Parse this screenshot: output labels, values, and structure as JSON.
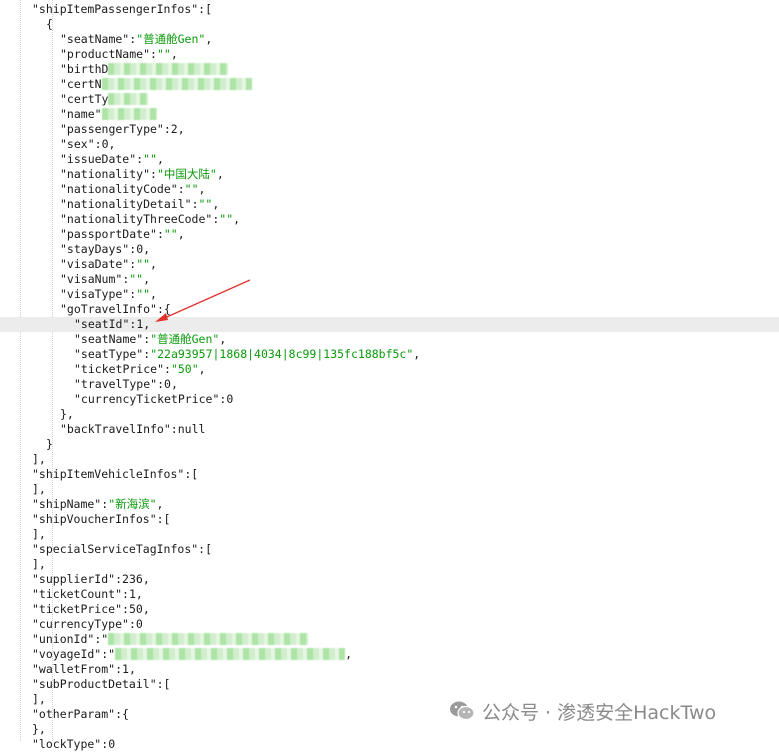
{
  "lines": [
    [
      {
        "t": "k",
        "v": "\"shipItemPassengerInfos\""
      },
      {
        "t": "p",
        "v": ":["
      }
    ],
    [
      {
        "t": "p",
        "v": "{"
      }
    ],
    [
      {
        "t": "k",
        "v": "\"seatName\""
      },
      {
        "t": "p",
        "v": ":"
      },
      {
        "t": "s",
        "v": "\"普通舱Gen\""
      },
      {
        "t": "p",
        "v": ","
      }
    ],
    [
      {
        "t": "k",
        "v": "\"productName\""
      },
      {
        "t": "p",
        "v": ":"
      },
      {
        "t": "s",
        "v": "\"\""
      },
      {
        "t": "p",
        "v": ","
      }
    ],
    [
      {
        "t": "k",
        "v": "\"birthD"
      },
      {
        "t": "m",
        "v": ""
      }
    ],
    [
      {
        "t": "k",
        "v": "\"certN"
      },
      {
        "t": "m",
        "v": ""
      }
    ],
    [
      {
        "t": "k",
        "v": "\"certTy"
      },
      {
        "t": "m",
        "v": ""
      }
    ],
    [
      {
        "t": "k",
        "v": "\"name\""
      },
      {
        "t": "m",
        "v": ""
      }
    ],
    [
      {
        "t": "k",
        "v": "\"passengerType\""
      },
      {
        "t": "p",
        "v": ":"
      },
      {
        "t": "n",
        "v": "2"
      },
      {
        "t": "p",
        "v": ","
      }
    ],
    [
      {
        "t": "k",
        "v": "\"sex\""
      },
      {
        "t": "p",
        "v": ":"
      },
      {
        "t": "n",
        "v": "0"
      },
      {
        "t": "p",
        "v": ","
      }
    ],
    [
      {
        "t": "k",
        "v": "\"issueDate\""
      },
      {
        "t": "p",
        "v": ":"
      },
      {
        "t": "s",
        "v": "\"\""
      },
      {
        "t": "p",
        "v": ","
      }
    ],
    [
      {
        "t": "k",
        "v": "\"nationality\""
      },
      {
        "t": "p",
        "v": ":"
      },
      {
        "t": "s",
        "v": "\"中国大陆\""
      },
      {
        "t": "p",
        "v": ","
      }
    ],
    [
      {
        "t": "k",
        "v": "\"nationalityCode\""
      },
      {
        "t": "p",
        "v": ":"
      },
      {
        "t": "s",
        "v": "\"\""
      },
      {
        "t": "p",
        "v": ","
      }
    ],
    [
      {
        "t": "k",
        "v": "\"nationalityDetail\""
      },
      {
        "t": "p",
        "v": ":"
      },
      {
        "t": "s",
        "v": "\"\""
      },
      {
        "t": "p",
        "v": ","
      }
    ],
    [
      {
        "t": "k",
        "v": "\"nationalityThreeCode\""
      },
      {
        "t": "p",
        "v": ":"
      },
      {
        "t": "s",
        "v": "\"\""
      },
      {
        "t": "p",
        "v": ","
      }
    ],
    [
      {
        "t": "k",
        "v": "\"passportDate\""
      },
      {
        "t": "p",
        "v": ":"
      },
      {
        "t": "s",
        "v": "\"\""
      },
      {
        "t": "p",
        "v": ","
      }
    ],
    [
      {
        "t": "k",
        "v": "\"stayDays\""
      },
      {
        "t": "p",
        "v": ":"
      },
      {
        "t": "n",
        "v": "0"
      },
      {
        "t": "p",
        "v": ","
      }
    ],
    [
      {
        "t": "k",
        "v": "\"visaDate\""
      },
      {
        "t": "p",
        "v": ":"
      },
      {
        "t": "s",
        "v": "\"\""
      },
      {
        "t": "p",
        "v": ","
      }
    ],
    [
      {
        "t": "k",
        "v": "\"visaNum\""
      },
      {
        "t": "p",
        "v": ":"
      },
      {
        "t": "s",
        "v": "\"\""
      },
      {
        "t": "p",
        "v": ","
      }
    ],
    [
      {
        "t": "k",
        "v": "\"visaType\""
      },
      {
        "t": "p",
        "v": ":"
      },
      {
        "t": "s",
        "v": "\"\""
      },
      {
        "t": "p",
        "v": ","
      }
    ],
    [
      {
        "t": "k",
        "v": "\"goTravelInfo\""
      },
      {
        "t": "p",
        "v": ":{"
      }
    ],
    [
      {
        "t": "k",
        "v": "\"seatId\""
      },
      {
        "t": "p",
        "v": ":"
      },
      {
        "t": "n",
        "v": "1"
      },
      {
        "t": "p",
        "v": ","
      }
    ],
    [
      {
        "t": "k",
        "v": "\"seatName\""
      },
      {
        "t": "p",
        "v": ":"
      },
      {
        "t": "s",
        "v": "\"普通舱Gen\""
      },
      {
        "t": "p",
        "v": ","
      }
    ],
    [
      {
        "t": "k",
        "v": "\"seatType\""
      },
      {
        "t": "p",
        "v": ":"
      },
      {
        "t": "s",
        "v": "\"22a93957|1868|4034|8c99|135fc188bf5c\""
      },
      {
        "t": "p",
        "v": ","
      }
    ],
    [
      {
        "t": "k",
        "v": "\"ticketPrice\""
      },
      {
        "t": "p",
        "v": ":"
      },
      {
        "t": "s",
        "v": "\"50\""
      },
      {
        "t": "p",
        "v": ","
      }
    ],
    [
      {
        "t": "k",
        "v": "\"travelType\""
      },
      {
        "t": "p",
        "v": ":"
      },
      {
        "t": "n",
        "v": "0"
      },
      {
        "t": "p",
        "v": ","
      }
    ],
    [
      {
        "t": "k",
        "v": "\"currencyTicketPrice\""
      },
      {
        "t": "p",
        "v": ":"
      },
      {
        "t": "n",
        "v": "0"
      }
    ],
    [
      {
        "t": "p",
        "v": "},"
      }
    ],
    [
      {
        "t": "k",
        "v": "\"backTravelInfo\""
      },
      {
        "t": "p",
        "v": ":"
      },
      {
        "t": "n",
        "v": "null"
      }
    ],
    [
      {
        "t": "p",
        "v": "}"
      }
    ],
    [
      {
        "t": "p",
        "v": "],"
      }
    ],
    [
      {
        "t": "k",
        "v": "\"shipItemVehicleInfos\""
      },
      {
        "t": "p",
        "v": ":["
      }
    ],
    [
      {
        "t": "p",
        "v": "],"
      }
    ],
    [
      {
        "t": "k",
        "v": "\"shipName\""
      },
      {
        "t": "p",
        "v": ":"
      },
      {
        "t": "s",
        "v": "\"新海滨\""
      },
      {
        "t": "p",
        "v": ","
      }
    ],
    [
      {
        "t": "k",
        "v": "\"shipVoucherInfos\""
      },
      {
        "t": "p",
        "v": ":["
      }
    ],
    [
      {
        "t": "p",
        "v": "],"
      }
    ],
    [
      {
        "t": "k",
        "v": "\"specialServiceTagInfos\""
      },
      {
        "t": "p",
        "v": ":["
      }
    ],
    [
      {
        "t": "p",
        "v": "],"
      }
    ],
    [
      {
        "t": "k",
        "v": "\"supplierId\""
      },
      {
        "t": "p",
        "v": ":"
      },
      {
        "t": "n",
        "v": "236"
      },
      {
        "t": "p",
        "v": ","
      }
    ],
    [
      {
        "t": "k",
        "v": "\"ticketCount\""
      },
      {
        "t": "p",
        "v": ":"
      },
      {
        "t": "n",
        "v": "1"
      },
      {
        "t": "p",
        "v": ","
      }
    ],
    [
      {
        "t": "k",
        "v": "\"ticketPrice\""
      },
      {
        "t": "p",
        "v": ":"
      },
      {
        "t": "n",
        "v": "50"
      },
      {
        "t": "p",
        "v": ","
      }
    ],
    [
      {
        "t": "k",
        "v": "\"currencyType\""
      },
      {
        "t": "p",
        "v": ":"
      },
      {
        "t": "n",
        "v": "0"
      }
    ],
    [
      {
        "t": "k",
        "v": "\"unionId\""
      },
      {
        "t": "p",
        "v": ":\""
      },
      {
        "t": "m",
        "v": ""
      }
    ],
    [
      {
        "t": "k",
        "v": "\"voyageId\""
      },
      {
        "t": "p",
        "v": ":\""
      },
      {
        "t": "m",
        "v": ""
      },
      {
        "t": "p",
        "v": ","
      }
    ],
    [
      {
        "t": "k",
        "v": "\"walletFrom\""
      },
      {
        "t": "p",
        "v": ":"
      },
      {
        "t": "n",
        "v": "1"
      },
      {
        "t": "p",
        "v": ","
      }
    ],
    [
      {
        "t": "k",
        "v": "\"subProductDetail\""
      },
      {
        "t": "p",
        "v": ":["
      }
    ],
    [
      {
        "t": "p",
        "v": "],"
      }
    ],
    [
      {
        "t": "k",
        "v": "\"otherParam\""
      },
      {
        "t": "p",
        "v": ":{"
      }
    ],
    [
      {
        "t": "p",
        "v": "},"
      }
    ],
    [
      {
        "t": "k",
        "v": "\"lockType\""
      },
      {
        "t": "p",
        "v": ":"
      },
      {
        "t": "n",
        "v": "0"
      }
    ]
  ],
  "highlighted_line": 21,
  "watermark": {
    "icon": "wechat-icon",
    "text": "公众号 · 渗透安全HackTwo"
  },
  "colors": {
    "string": "#0a9a0a",
    "key": "#1a1a1a",
    "highlight": "#ececec",
    "arrow": "#e0322b",
    "mask": "#a7e3a1",
    "watermark": "#8a8a8a"
  }
}
